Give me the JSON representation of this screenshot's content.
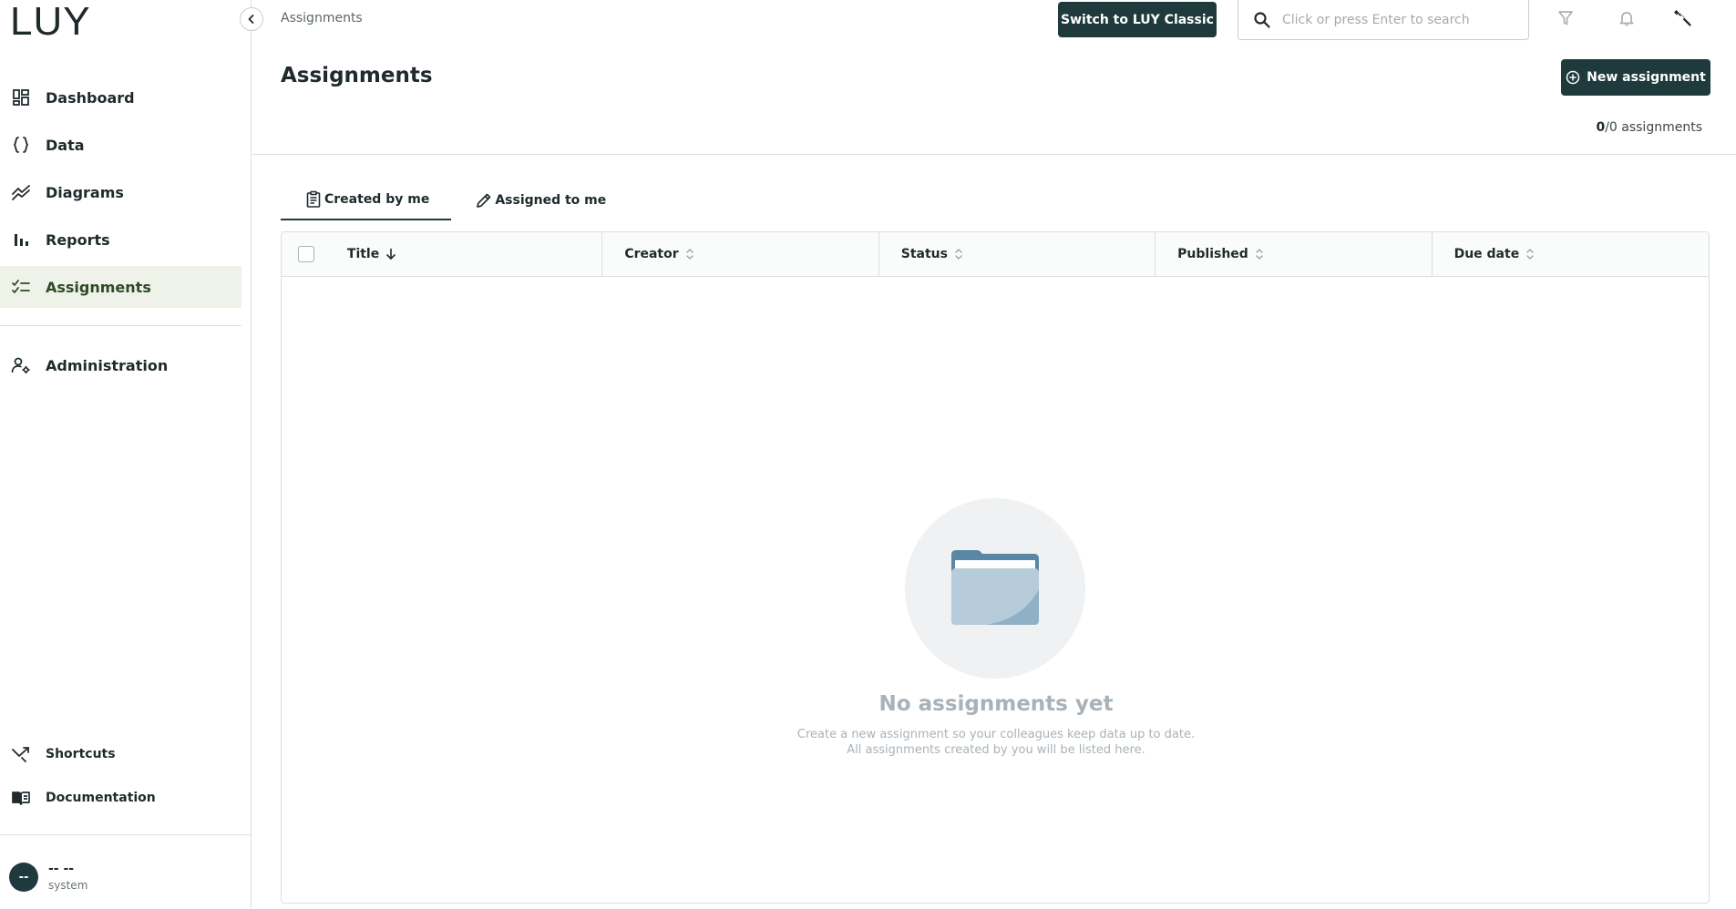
{
  "app": {
    "logo": "LUY"
  },
  "sidebar": {
    "collapse_icon": "chevron-left-icon",
    "items": [
      {
        "label": "Dashboard",
        "icon": "dashboard-icon"
      },
      {
        "label": "Data",
        "icon": "braces-icon"
      },
      {
        "label": "Diagrams",
        "icon": "trend-line-icon"
      },
      {
        "label": "Reports",
        "icon": "bar-chart-icon"
      },
      {
        "label": "Assignments",
        "icon": "checklist-icon",
        "active": true
      }
    ],
    "admin": {
      "label": "Administration",
      "icon": "user-gear-icon"
    },
    "bottom": [
      {
        "label": "Shortcuts",
        "icon": "shortcut-arrow-icon"
      },
      {
        "label": "Documentation",
        "icon": "book-icon"
      }
    ],
    "user": {
      "initials": "--",
      "name": "-- --",
      "role": "system"
    }
  },
  "topbar": {
    "breadcrumb": "Assignments",
    "classic_button": "Switch to LUY Classic",
    "search_placeholder": "Click or press Enter to search",
    "icons": [
      "filter-icon",
      "bell-icon",
      "wrench-icon"
    ]
  },
  "header": {
    "title": "Assignments",
    "new_button": "New assignment",
    "count_shown": "0",
    "count_rest": "/0 assignments"
  },
  "tabs": [
    {
      "label": "Created by me",
      "icon": "clipboard-icon",
      "active": true
    },
    {
      "label": "Assigned to me",
      "icon": "pencil-icon",
      "active": false
    }
  ],
  "table": {
    "columns": [
      {
        "label": "Title",
        "sort": "desc"
      },
      {
        "label": "Creator",
        "sort": "none"
      },
      {
        "label": "Status",
        "sort": "none"
      },
      {
        "label": "Published",
        "sort": "none"
      },
      {
        "label": "Due date",
        "sort": "none"
      }
    ],
    "rows": []
  },
  "empty": {
    "icon": "folder-icon",
    "title": "No assignments yet",
    "line1": "Create a new assignment so your colleagues keep data up to date.",
    "line2": "All assignments created by you will be listed here."
  },
  "colors": {
    "primary": "#1f3a3d",
    "active_nav_bg": "#eff2e8",
    "logo_accent": "#b7c34a",
    "empty_text": "#a8b2b8"
  }
}
